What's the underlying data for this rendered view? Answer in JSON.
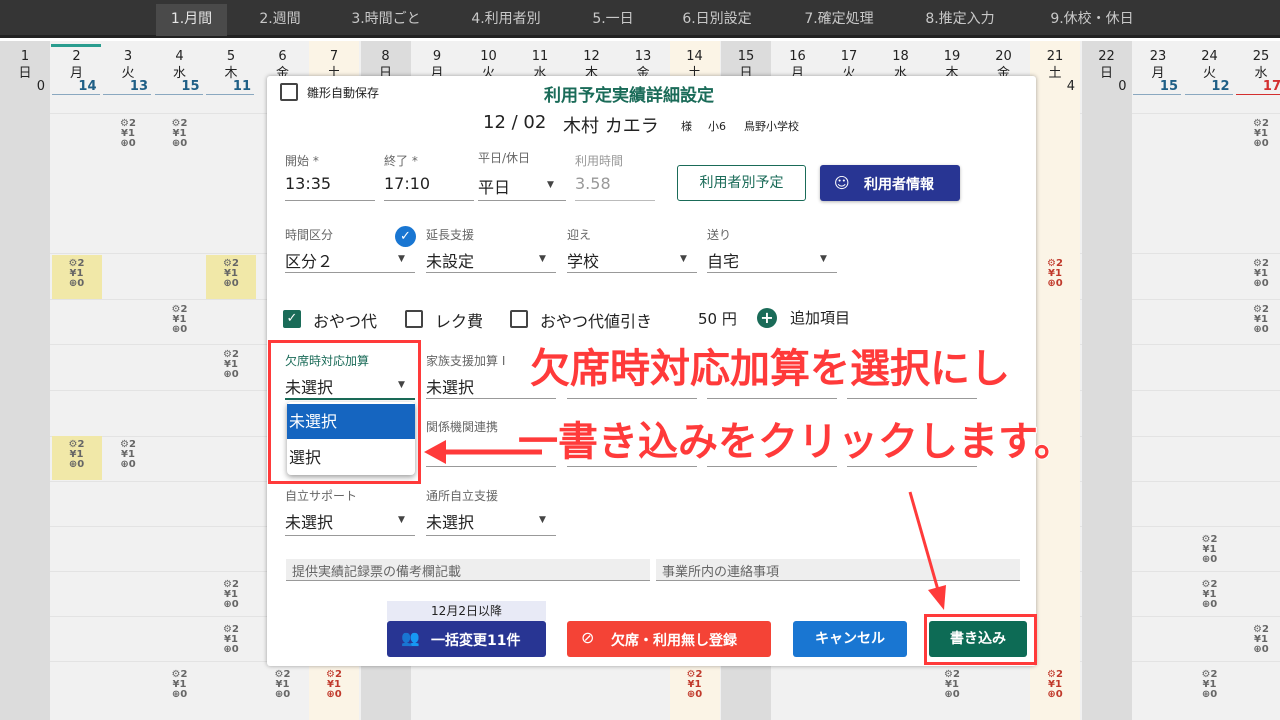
{
  "nav": {
    "tabs": [
      "1.月間",
      "2.週間",
      "3.時間ごと",
      "4.利用者別",
      "5.一日",
      "6.日別設定",
      "7.確定処理",
      "8.推定入力",
      "9.休校・休日"
    ]
  },
  "days": [
    {
      "d": "1",
      "w": "日",
      "c": "0"
    },
    {
      "d": "2",
      "w": "月",
      "c": "14"
    },
    {
      "d": "3",
      "w": "火",
      "c": "13"
    },
    {
      "d": "4",
      "w": "水",
      "c": "15"
    },
    {
      "d": "5",
      "w": "木",
      "c": "11"
    },
    {
      "d": "6",
      "w": "金",
      "c": ""
    },
    {
      "d": "7",
      "w": "土",
      "c": ""
    },
    {
      "d": "8",
      "w": "日",
      "c": ""
    },
    {
      "d": "9",
      "w": "月",
      "c": ""
    },
    {
      "d": "10",
      "w": "火",
      "c": ""
    },
    {
      "d": "11",
      "w": "水",
      "c": ""
    },
    {
      "d": "12",
      "w": "木",
      "c": ""
    },
    {
      "d": "13",
      "w": "金",
      "c": ""
    },
    {
      "d": "14",
      "w": "土",
      "c": ""
    },
    {
      "d": "15",
      "w": "日",
      "c": ""
    },
    {
      "d": "16",
      "w": "月",
      "c": ""
    },
    {
      "d": "17",
      "w": "火",
      "c": ""
    },
    {
      "d": "18",
      "w": "水",
      "c": ""
    },
    {
      "d": "19",
      "w": "木",
      "c": ""
    },
    {
      "d": "20",
      "w": "金",
      "c": ""
    },
    {
      "d": "21",
      "w": "土",
      "c": "4"
    },
    {
      "d": "22",
      "w": "日",
      "c": "0"
    },
    {
      "d": "23",
      "w": "月",
      "c": "15"
    },
    {
      "d": "24",
      "w": "火",
      "c": "12"
    },
    {
      "d": "25",
      "w": "水",
      "c": "17"
    }
  ],
  "cell_icon": "¥1",
  "modal": {
    "autosave_label": "雛形自動保存",
    "title": "利用予定実績詳細設定",
    "date": "12 / 02",
    "user_name": "木村 カエラ",
    "honorific": "様",
    "grade": "小6",
    "school": "鳥野小学校",
    "start": {
      "label": "開始 *",
      "value": "13:35"
    },
    "end": {
      "label": "終了 *",
      "value": "17:10"
    },
    "daytype": {
      "label": "平日/休日",
      "value": "平日"
    },
    "usage_time": {
      "label": "利用時間",
      "value": "3.58"
    },
    "btn_user_plan": "利用者別予定",
    "btn_user_info": "利用者情報",
    "time_class": {
      "label": "時間区分",
      "value": "区分２"
    },
    "ext_support": {
      "label": "延長支援",
      "value": "未設定"
    },
    "pickup": {
      "label": "迎え",
      "value": "学校"
    },
    "dropoff": {
      "label": "送り",
      "value": "自宅"
    },
    "snack": "おやつ代",
    "rec_fee": "レク費",
    "snack_discount": "おやつ代値引き",
    "price": "50 円",
    "add_item": "追加項目",
    "absence_add": {
      "label": "欠席時対応加算",
      "value": "未選択"
    },
    "family_support": {
      "label": "家族支援加算 I",
      "value": "未選択"
    },
    "agency_link": {
      "label": "関係機関連携"
    },
    "self_support": {
      "label": "自立サポート",
      "value": "未選択"
    },
    "commute_support": {
      "label": "通所自立支援",
      "value": "未選択"
    },
    "remarks_placeholder": "提供実績記録票の備考欄記載",
    "office_notes_placeholder": "事業所内の連絡事項",
    "bulk_note": "12月2日以降",
    "btn_bulk": "一括変更11件",
    "btn_absence": "欠席・利用無し登録",
    "btn_cancel": "キャンセル",
    "btn_write": "書き込み"
  },
  "dropdown": {
    "options": [
      "未選択",
      "選択"
    ],
    "selected": "未選択"
  },
  "annotation": {
    "line1": "欠席時対応加算を選択にし",
    "line2": "一書き込みをクリックします。"
  },
  "colors": {
    "primary": "#283593",
    "write": "#0d6b55",
    "danger": "#f44336",
    "cancel": "#1976d2",
    "annotation": "#ff3a3a"
  }
}
